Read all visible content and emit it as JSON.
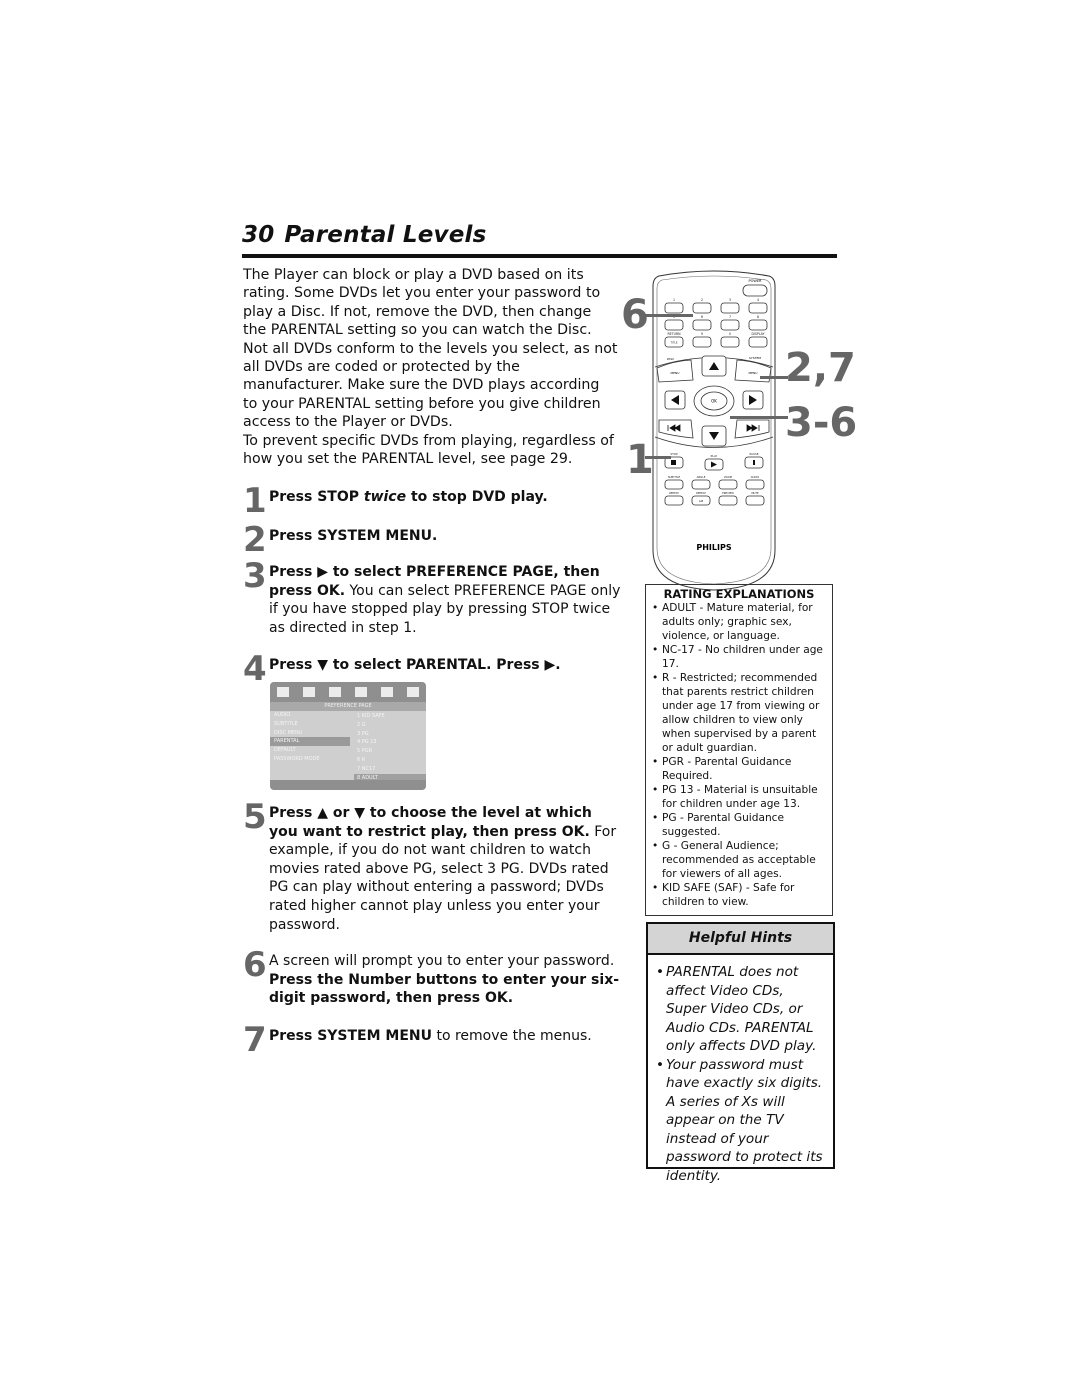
{
  "page": {
    "number": "30",
    "title": "Parental Levels"
  },
  "intro": {
    "p1": "The Player can block or play a DVD based on its rating. Some DVDs let you enter your password to play a Disc. If not, remove the DVD, then change the PARENTAL setting so you can watch the Disc.",
    "p2": "Not all DVDs conform to the levels you select, as not all DVDs are coded or protected by the manufacturer.  Make sure the DVD plays according to your PARENTAL setting before you give children access to the Player or DVDs.",
    "p3": "To prevent specific DVDs from playing, regardless of how you set the PARENTAL level, see page 29."
  },
  "steps": [
    {
      "number": "1",
      "parts": [
        "Press STOP ",
        "twice",
        " to stop DVD play."
      ]
    },
    {
      "number": "2",
      "parts": [
        "Press SYSTEM MENU."
      ]
    },
    {
      "number": "3",
      "parts": [
        "Press ▶ to select PREFERENCE PAGE, then press OK.",
        " You can select PREFERENCE PAGE only if you have stopped play by pressing STOP twice as directed in step 1."
      ]
    },
    {
      "number": "4",
      "parts": [
        "Press ▼ to select PARENTAL. Press ▶."
      ]
    },
    {
      "number": "5",
      "parts": [
        "Press ▲ or ▼ to choose the level at which you want to restrict play, then press OK.",
        " For example, if you do not want children to watch movies rated above PG, select 3 PG. DVDs rated PG can play without entering a password; DVDs rated higher cannot play unless you enter your password."
      ]
    },
    {
      "number": "6",
      "parts": [
        "A screen will prompt you to enter your password. ",
        "Press the Number buttons to enter your six-digit password, then press OK."
      ]
    },
    {
      "number": "7",
      "parts": [
        "Press SYSTEM MENU",
        " to remove the menus."
      ]
    }
  ],
  "menu_screenshot": {
    "header": "PREFERENCE PAGE",
    "items": [
      "AUDIO",
      "SUBTITLE",
      "DISC MENU",
      "PARENTAL",
      "DEFAULT",
      "PASSWORD MODE"
    ],
    "selected_item": "PARENTAL",
    "values": [
      "1 KID SAFE",
      "2 G",
      "3 PG",
      "4 PG 13",
      "5 PGR",
      "6 R",
      "7 NC17",
      "8 ADULT"
    ],
    "selected_value": "8 ADULT"
  },
  "remote": {
    "brand": "PHILIPS",
    "buttons": {
      "power": "POWER",
      "numbers": [
        "1",
        "2",
        "3",
        "4",
        "5",
        "6",
        "7",
        "8",
        "9",
        "0"
      ],
      "return": "RETURN",
      "title": "TITLE",
      "display": "DISPLAY",
      "disc": "DISC",
      "menu": "MENU",
      "system": "SYSTEM",
      "ok": "OK",
      "stop": "STOP",
      "play": "PLAY",
      "pause": "PAUSE",
      "subtitle": "SUBTITLE",
      "angle": "ANGLE",
      "zoom": "ZOOM",
      "audio": "AUDIO",
      "repeat": "REPEAT",
      "repeat_ab": "REPEAT",
      "ab": "A-B",
      "preview": "PREVIEW",
      "mute": "MUTE"
    },
    "callouts": {
      "left_top": "6",
      "left_bottom": "1",
      "right_top": "2,7",
      "right_mid": "3-6"
    }
  },
  "rating_box": {
    "heading": "RATING EXPLANATIONS",
    "items": [
      "ADULT - Mature material, for adults only; graphic sex, violence, or language.",
      "NC-17 - No children under age 17.",
      "R - Restricted; recommended that parents restrict children under age 17 from viewing or allow children to view only when supervised by a parent or adult guardian.",
      "PGR - Parental Guidance Required.",
      "PG 13 - Material is unsuitable for children under age 13.",
      "PG - Parental Guidance suggested.",
      "G - General Audience; recommended as acceptable for viewers of all ages.",
      "KID SAFE (SAF) - Safe for children to view."
    ]
  },
  "hints": {
    "heading": "Helpful Hints",
    "items": [
      "PARENTAL does not affect Video CDs, Super Video CDs, or Audio CDs. PARENTAL only affects DVD play.",
      "Your password must have exactly six digits. A series of Xs will appear on the TV instead of your password to protect its identity."
    ]
  }
}
